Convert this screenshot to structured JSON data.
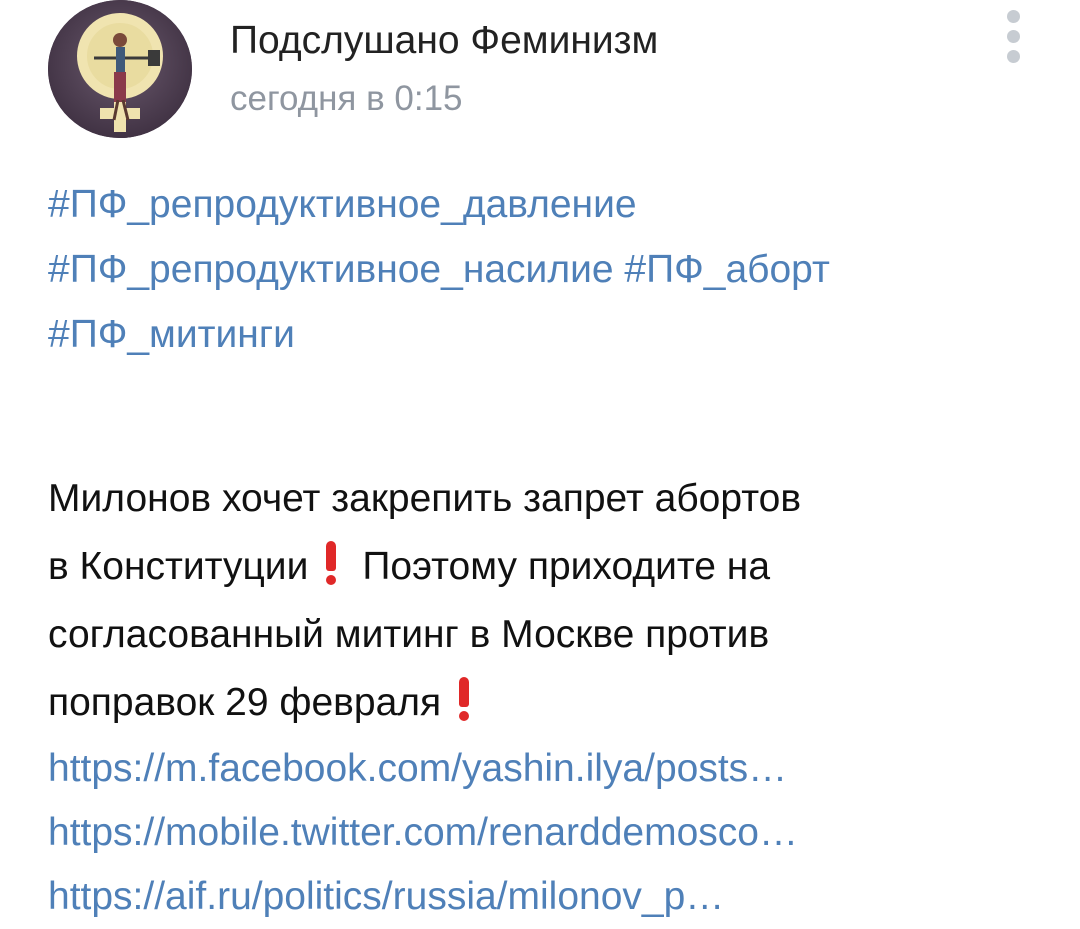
{
  "post": {
    "author": "Подслушано Феминизм",
    "time": "сегодня в 0:15",
    "tags": [
      [
        "#ПФ_репродуктивное_давление"
      ],
      [
        "#ПФ_репродуктивное_насилие",
        "#ПФ_аборт"
      ],
      [
        "#ПФ_митинги"
      ]
    ],
    "text": {
      "line1": "Милонов хочет закрепить запрет абортов",
      "line2_before": "в Конституции",
      "line2_after": "Поэтому приходите на",
      "line3": "согласованный митинг в Москве против",
      "line4": "поправок 29 февраля"
    },
    "links": [
      "https://m.facebook.com/yashin.ilya/posts…",
      "https://mobile.twitter.com/renarddemosco…",
      "https://aif.ru/politics/russia/milonov_p…"
    ]
  },
  "icons": {
    "avatar": "feminism-symbol-avatar",
    "menu": "more-vertical-icon",
    "emphasis": "red-exclamation-icon"
  },
  "colors": {
    "link": "#4f80b8",
    "time": "#8f96a0",
    "menu_dots": "#c7ccd2",
    "exclamation": "#e02828"
  }
}
